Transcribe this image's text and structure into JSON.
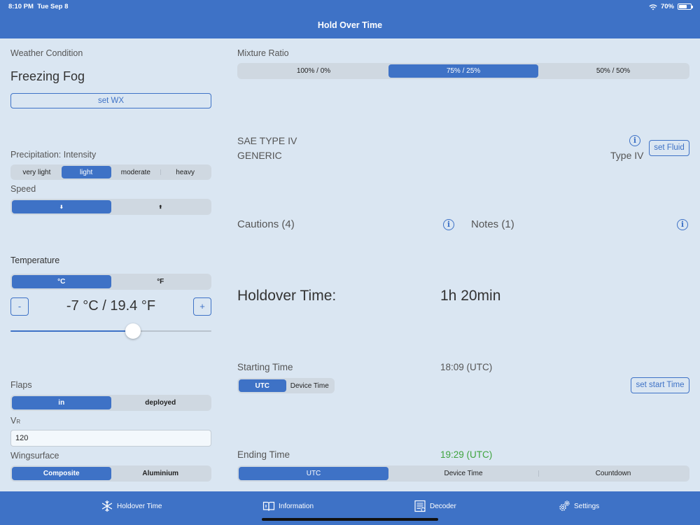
{
  "status": {
    "time": "8:10 PM",
    "date": "Tue Sep 8",
    "battery": "70%",
    "battery_level": 0.7
  },
  "nav": {
    "title": "Hold Over Time"
  },
  "weather": {
    "label": "Weather Condition",
    "value": "Freezing Fog",
    "set_button": "set WX"
  },
  "precip": {
    "label": "Precipitation: Intensity",
    "options": [
      "very light",
      "light",
      "moderate",
      "heavy"
    ],
    "selected": "light"
  },
  "speed": {
    "label": "Speed",
    "options": [
      "⬇",
      "⬆"
    ]
  },
  "temperature": {
    "label": "Temperature",
    "units": [
      "°C",
      "°F"
    ],
    "value": "-7 °C / 19.4 °F",
    "minus": "-",
    "plus": "+",
    "slider_value": 0.61
  },
  "flaps": {
    "label": "Flaps",
    "options": [
      "in",
      "deployed"
    ]
  },
  "vr": {
    "label_main": "V",
    "label_sub": "R",
    "value": "120"
  },
  "wingsurface": {
    "label": "Wingsurface",
    "options": [
      "Composite",
      "Aluminium"
    ]
  },
  "mixture": {
    "label": "Mixture Ratio",
    "options": [
      "100% / 0%",
      "75% / 25%",
      "50% / 50%"
    ]
  },
  "fluid": {
    "name": "SAE TYPE IV",
    "brand": "GENERIC",
    "type": "Type IV",
    "set_button": "set Fluid",
    "info_glyph": "i"
  },
  "cautions": {
    "label": "Cautions (4)"
  },
  "notes": {
    "label": "Notes (1)"
  },
  "holdover": {
    "label": "Holdover Time:",
    "value": "1h 20min"
  },
  "starting": {
    "label": "Starting Time",
    "value": "18:09 (UTC)",
    "options": [
      "UTC",
      "Device Time"
    ],
    "set_button": "set start Time"
  },
  "ending": {
    "label": "Ending Time",
    "value": "19:29 (UTC)",
    "value_color": "#3ea33e",
    "options": [
      "UTC",
      "Device Time",
      "Countdown"
    ]
  },
  "tabs": [
    {
      "label": "Holdover Time",
      "icon": "snowflake-icon"
    },
    {
      "label": "Information",
      "icon": "book-icon"
    },
    {
      "label": "Decoder",
      "icon": "document-icon"
    },
    {
      "label": "Settings",
      "icon": "gears-icon"
    }
  ],
  "colors": {
    "accent": "#3e72c6",
    "background": "#dae6f2",
    "segment_bg": "#cfd8e1"
  }
}
